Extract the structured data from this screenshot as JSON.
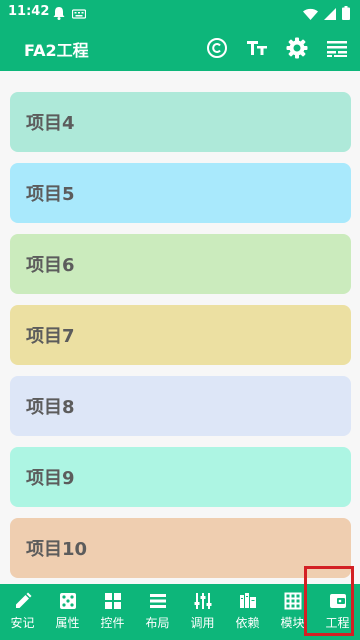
{
  "status_bar": {
    "time": "11:42"
  },
  "app_bar": {
    "title": "FA2工程",
    "actions": [
      "copyright-icon",
      "text-size-icon",
      "settings-icon",
      "subtitles-icon"
    ]
  },
  "items": [
    {
      "label": "项目4",
      "color": "#aee9d9"
    },
    {
      "label": "项目5",
      "color": "#a9e9fc"
    },
    {
      "label": "项目6",
      "color": "#cbebbd"
    },
    {
      "label": "项目7",
      "color": "#ece0a2"
    },
    {
      "label": "项目8",
      "color": "#dde6f7"
    },
    {
      "label": "项目9",
      "color": "#adf5e3"
    },
    {
      "label": "项目10",
      "color": "#efceb0"
    }
  ],
  "bottom_nav": [
    {
      "label": "安记",
      "icon": "pencil-icon"
    },
    {
      "label": "属性",
      "icon": "dice-icon"
    },
    {
      "label": "控件",
      "icon": "widgets-icon"
    },
    {
      "label": "布局",
      "icon": "list-icon"
    },
    {
      "label": "调用",
      "icon": "sliders-icon"
    },
    {
      "label": "依赖",
      "icon": "library-icon"
    },
    {
      "label": "模块",
      "icon": "grid-icon"
    },
    {
      "label": "工程",
      "icon": "wallet-icon"
    }
  ],
  "colors": {
    "primary": "#0db67a",
    "highlight": "#d32024"
  }
}
